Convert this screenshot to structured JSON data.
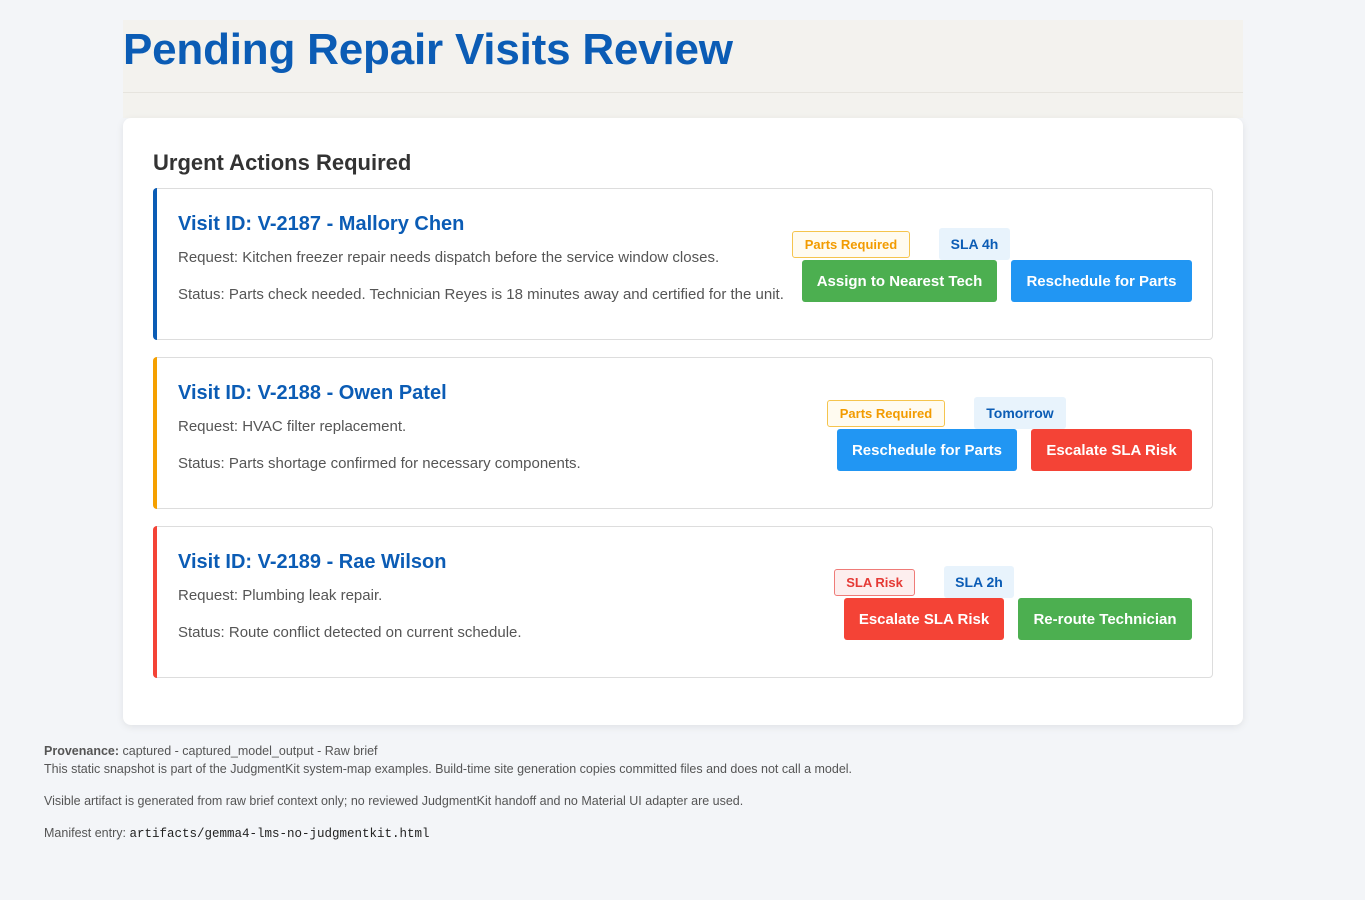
{
  "header": {
    "title": "Pending Repair Visits Review"
  },
  "panel": {
    "section_title": "Urgent Actions Required"
  },
  "visits": [
    {
      "title": "Visit ID: V-2187 - Mallory Chen",
      "request": "Request: Kitchen freezer repair needs dispatch before the service window closes.",
      "status": "Status: Parts check needed. Technician Reyes is 18 minutes away and certified for the unit.",
      "accent_color": "#0b5cb5",
      "badges": [
        {
          "label": "Parts Required",
          "kind": "parts"
        },
        {
          "label": "SLA 4h",
          "kind": "sla"
        }
      ],
      "actions": [
        {
          "label": "Assign to Nearest Tech",
          "color": "#4caf50"
        },
        {
          "label": "Reschedule for Parts",
          "color": "#2196f3"
        }
      ]
    },
    {
      "title": "Visit ID: V-2188 - Owen Patel",
      "request": "Request: HVAC filter replacement.",
      "status": "Status: Parts shortage confirmed for necessary components.",
      "accent_color": "#f5a000",
      "badges": [
        {
          "label": "Parts Required",
          "kind": "parts"
        },
        {
          "label": "Tomorrow",
          "kind": "sla"
        }
      ],
      "actions": [
        {
          "label": "Reschedule for Parts",
          "color": "#2196f3"
        },
        {
          "label": "Escalate SLA Risk",
          "color": "#f44336"
        }
      ]
    },
    {
      "title": "Visit ID: V-2189 - Rae Wilson",
      "request": "Request: Plumbing leak repair.",
      "status": "Status: Route conflict detected on current schedule.",
      "accent_color": "#f44336",
      "badges": [
        {
          "label": "SLA Risk",
          "kind": "risk"
        },
        {
          "label": "SLA 2h",
          "kind": "sla"
        }
      ],
      "actions": [
        {
          "label": "Escalate SLA Risk",
          "color": "#f44336"
        },
        {
          "label": "Re-route Technician",
          "color": "#4caf50"
        }
      ]
    }
  ],
  "footer": {
    "provenance_label": "Provenance:",
    "provenance_value": "captured - captured_model_output - Raw brief",
    "snapshot_note": "This static snapshot is part of the JudgmentKit system-map examples. Build-time site generation copies committed files and does not call a model.",
    "artifact_note": "Visible artifact is generated from raw brief context only; no reviewed JudgmentKit handoff and no Material UI adapter are used.",
    "manifest_label": "Manifest entry:",
    "manifest_path": "artifacts/gemma4-lms-no-judgmentkit.html"
  }
}
